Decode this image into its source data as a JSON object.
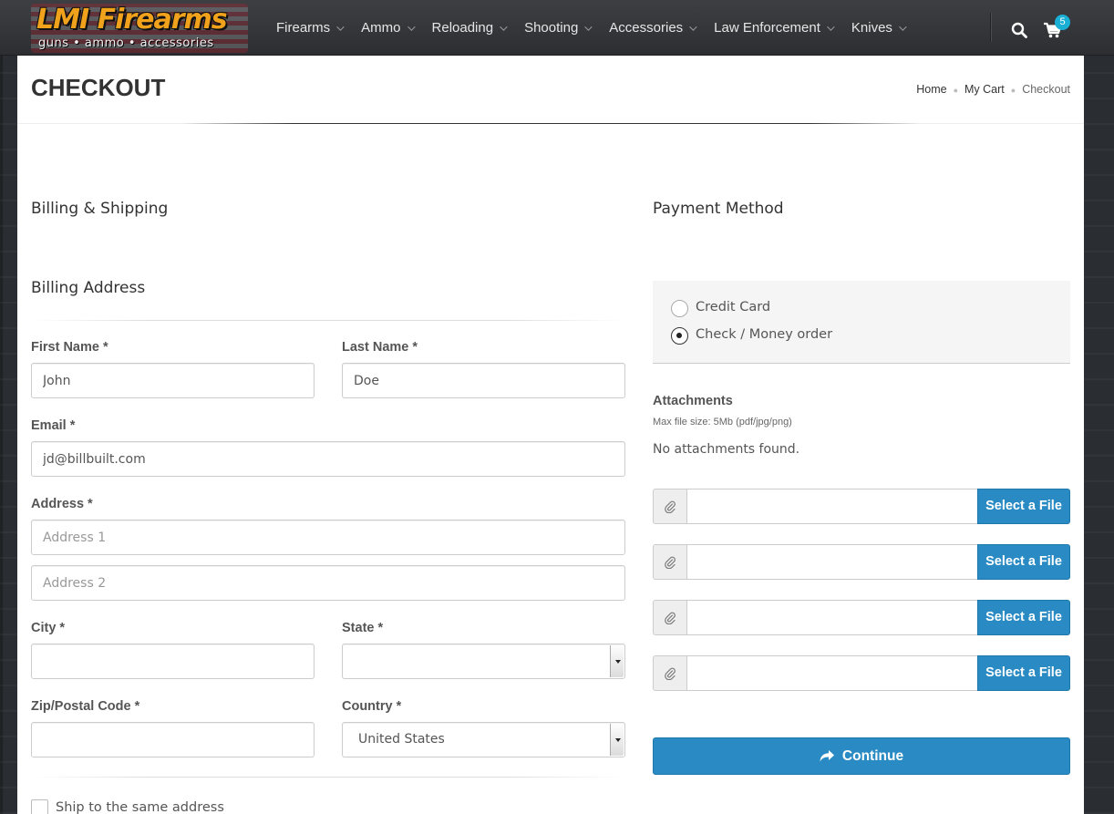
{
  "brand": {
    "name": "LMI Firearms",
    "tagline": "guns • ammo • accessories"
  },
  "nav": {
    "items": [
      {
        "label": "Firearms"
      },
      {
        "label": "Ammo"
      },
      {
        "label": "Reloading"
      },
      {
        "label": "Shooting"
      },
      {
        "label": "Accessories"
      },
      {
        "label": "Law Enforcement"
      },
      {
        "label": "Knives"
      }
    ],
    "cart_count": "5"
  },
  "page": {
    "title": "CHECKOUT",
    "breadcrumb": [
      "Home",
      "My Cart",
      "Checkout"
    ]
  },
  "billing": {
    "heading": "Billing & Shipping",
    "subheading": "Billing Address",
    "first_name_label": "First Name *",
    "first_name_value": "John",
    "last_name_label": "Last Name *",
    "last_name_value": "Doe",
    "email_label": "Email *",
    "email_value": "jd@billbuilt.com",
    "address_label": "Address *",
    "address1_placeholder": "Address 1",
    "address2_placeholder": "Address 2",
    "city_label": "City *",
    "city_value": "",
    "state_label": "State *",
    "state_value": "",
    "zip_label": "Zip/Postal Code *",
    "zip_value": "",
    "country_label": "Country *",
    "country_value": "United States",
    "ship_same_label": "Ship to the same address",
    "ship_same_checked": false
  },
  "payment": {
    "heading": "Payment Method",
    "options": [
      {
        "label": "Credit Card",
        "selected": false
      },
      {
        "label": "Check / Money order",
        "selected": true
      }
    ],
    "attachments_title": "Attachments",
    "attachments_note": "Max file size: 5Mb (pdf/jpg/png)",
    "attachments_empty": "No attachments found.",
    "select_file_label": "Select a File",
    "continue_label": "Continue"
  },
  "colors": {
    "accent": "#2a8bc4",
    "badge": "#1ab0d6",
    "logo": "#f0a21c"
  }
}
